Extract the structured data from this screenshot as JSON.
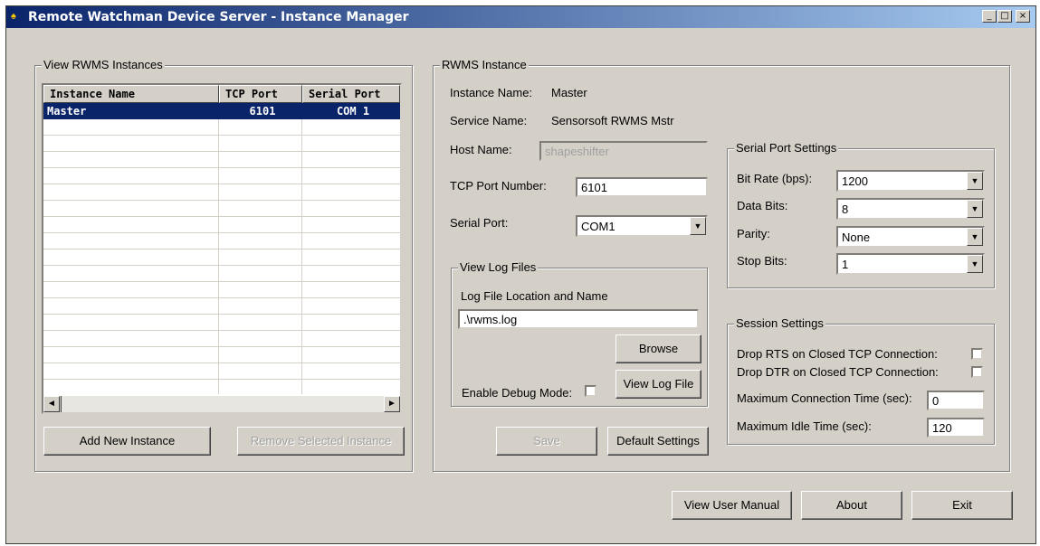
{
  "window": {
    "title": "Remote Watchman Device Server - Instance Manager",
    "controls": {
      "minimize": "_",
      "maximize": "□",
      "close": "×"
    }
  },
  "instances_group": {
    "label": "View RWMS Instances",
    "columns": [
      "Instance Name",
      "TCP Port",
      "Serial Port"
    ],
    "rows": [
      {
        "name": "Master",
        "tcp": "6101",
        "serial": "COM 1",
        "selected": true
      }
    ],
    "add_button": "Add New Instance",
    "remove_button": "Remove Selected Instance"
  },
  "instance_group": {
    "label": "RWMS Instance",
    "instance_name_label": "Instance Name:",
    "instance_name_value": "Master",
    "service_name_label": "Service Name:",
    "service_name_value": "Sensorsoft RWMS Mstr",
    "host_name_label": "Host Name:",
    "host_name_value": "shapeshifter",
    "tcp_port_label": "TCP Port Number:",
    "tcp_port_value": "6101",
    "serial_port_label": "Serial Port:",
    "serial_port_value": "COM1",
    "log_group": {
      "label": "View Log Files",
      "location_label": "Log File Location and Name",
      "location_value": ".\\rwms.log",
      "browse_button": "Browse",
      "debug_label": "Enable Debug Mode:",
      "view_log_button": "View Log File"
    },
    "save_button": "Save",
    "default_button": "Default Settings"
  },
  "serial_settings": {
    "label": "Serial Port Settings",
    "bit_rate_label": "Bit Rate (bps):",
    "bit_rate_value": "1200",
    "data_bits_label": "Data Bits:",
    "data_bits_value": "8",
    "parity_label": "Parity:",
    "parity_value": "None",
    "stop_bits_label": "Stop Bits:",
    "stop_bits_value": "1"
  },
  "session_settings": {
    "label": "Session Settings",
    "drop_rts_label": "Drop RTS on Closed TCP Connection:",
    "drop_dtr_label": "Drop DTR on Closed TCP Connection:",
    "max_conn_label": "Maximum Connection Time (sec):",
    "max_conn_value": "0",
    "max_idle_label": "Maximum Idle Time (sec):",
    "max_idle_value": "120"
  },
  "footer": {
    "manual_button": "View User Manual",
    "about_button": "About",
    "exit_button": "Exit"
  },
  "icons": {
    "dropdown": "▼",
    "scroll_left": "◄",
    "scroll_right": "►"
  }
}
